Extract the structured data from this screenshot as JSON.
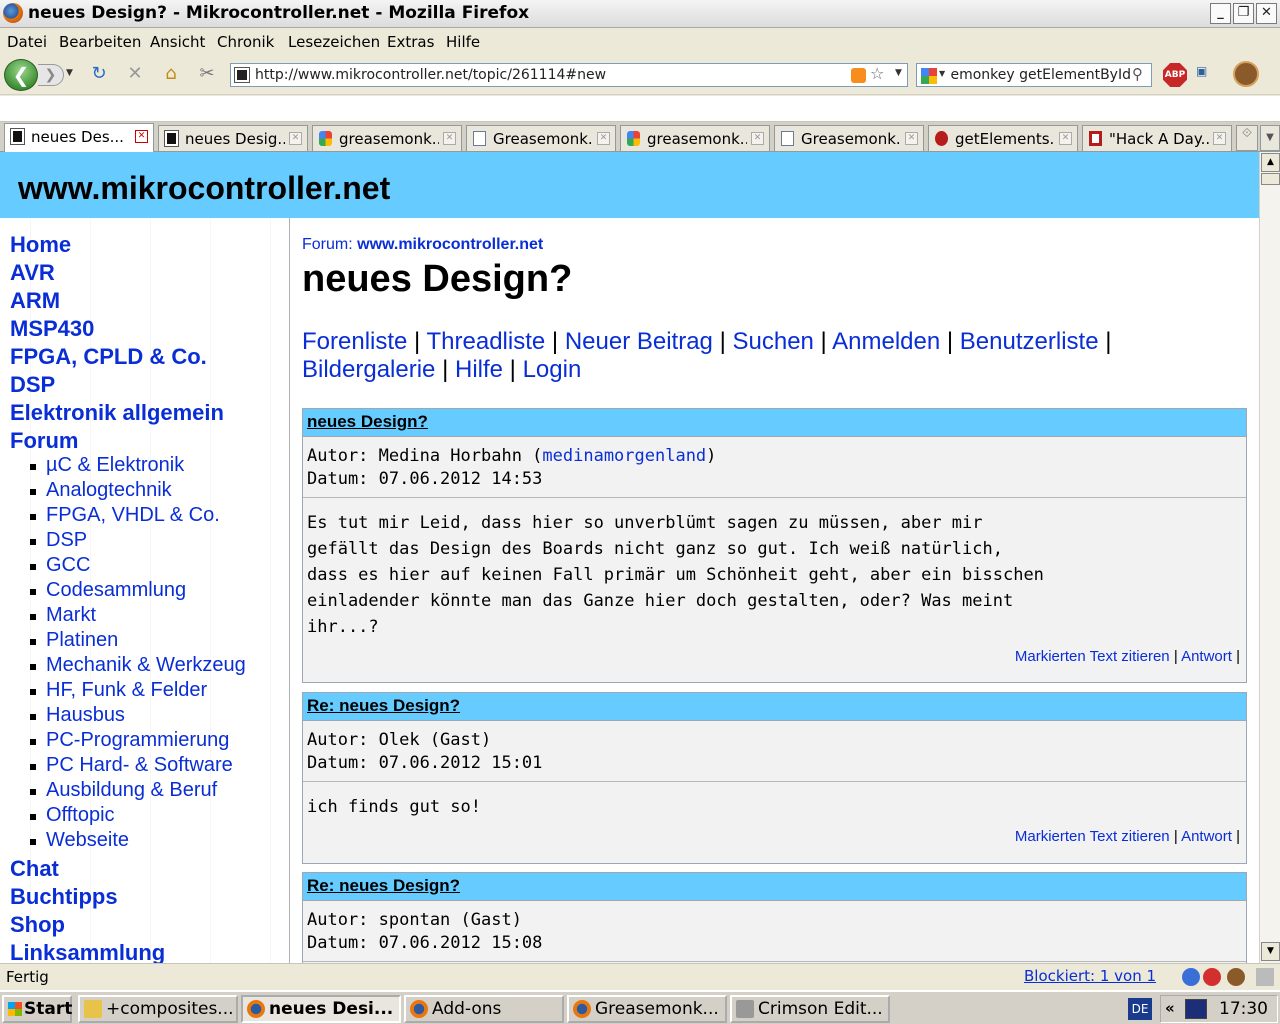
{
  "window": {
    "title": "neues Design? - Mikrocontroller.net - Mozilla Firefox",
    "min": "_",
    "max": "❐",
    "close": "✕"
  },
  "menu": [
    "Datei",
    "Bearbeiten",
    "Ansicht",
    "Chronik",
    "Lesezeichen",
    "Extras",
    "Hilfe"
  ],
  "nav": {
    "url": "http://www.mikrocontroller.net/topic/261114#new",
    "search_value": "emonkey getElementById",
    "abp_label": "ABP"
  },
  "tabs": [
    {
      "label": "neues Des...",
      "icon": "page-icon",
      "active": true
    },
    {
      "label": "neues Desig...",
      "icon": "page-icon",
      "active": false
    },
    {
      "label": "greasemonk...",
      "icon": "google-icon",
      "active": false
    },
    {
      "label": "Greasemonk...",
      "icon": "doc-icon",
      "active": false
    },
    {
      "label": "greasemonk...",
      "icon": "google-icon",
      "active": false
    },
    {
      "label": "Greasemonk...",
      "icon": "doc-icon",
      "active": false
    },
    {
      "label": "getElements...",
      "icon": "bug-icon",
      "active": false
    },
    {
      "label": "\"Hack A Day...",
      "icon": "hackaday-icon",
      "active": false
    }
  ],
  "site": {
    "title": "www.mikrocontroller.net"
  },
  "leftnav": {
    "main_top": [
      "Home",
      "AVR",
      "ARM",
      "MSP430",
      "FPGA, CPLD & Co.",
      "DSP",
      "Elektronik allgemein",
      "Forum"
    ],
    "sub": [
      "µC & Elektronik",
      "Analogtechnik",
      "FPGA, VHDL & Co.",
      "DSP",
      "GCC",
      "Codesammlung",
      "Markt",
      "Platinen",
      "Mechanik & Werkzeug",
      "HF, Funk & Felder",
      "Hausbus",
      "PC-Programmierung",
      "PC Hard- & Software",
      "Ausbildung & Beruf",
      "Offtopic",
      "Webseite"
    ],
    "main_bottom": [
      "Chat",
      "Buchtipps",
      "Shop",
      "Linksammlung"
    ]
  },
  "main": {
    "crumb_prefix": "Forum: ",
    "crumb_link": "www.mikrocontroller.net",
    "page_title": "neues Design?",
    "links": [
      "Forenliste",
      "Threadliste",
      "Neuer Beitrag",
      "Suchen",
      "Anmelden",
      "Benutzerliste",
      "Bildergalerie",
      "Hilfe",
      "Login"
    ],
    "separator": " | "
  },
  "posts": [
    {
      "subject": "neues Design?",
      "author_prefix": "Autor: Medina Horbahn (",
      "author_link": "medinamorgenland",
      "author_suffix": ")",
      "date": "Datum: 07.06.2012 14:53",
      "body": "Es tut mir Leid, dass hier so unverblümt sagen zu müssen, aber mir\ngefällt das Design des Boards nicht ganz so gut. Ich weiß natürlich,\ndass es hier auf keinen Fall primär um Schönheit geht, aber ein bisschen\neinladender könnte man das Ganze hier doch gestalten, oder? Was meint\nihr...?",
      "quote": "Markierten Text zitieren",
      "reply": "Antwort"
    },
    {
      "subject": "Re: neues Design?",
      "author_prefix": "Autor: Olek (Gast)",
      "author_link": "",
      "author_suffix": "",
      "date": "Datum: 07.06.2012 15:01",
      "body": "ich finds gut so!",
      "quote": "Markierten Text zitieren",
      "reply": "Antwort"
    },
    {
      "subject": "Re: neues Design?",
      "author_prefix": "Autor: spontan (Gast)",
      "author_link": "",
      "author_suffix": "",
      "date": "Datum: 07.06.2012 15:08",
      "body": "",
      "quote": "",
      "reply": ""
    }
  ],
  "status": {
    "text": "Fertig",
    "blocked": "Blockiert: 1 von 1"
  },
  "taskbar": {
    "start": "Start",
    "items": [
      {
        "label": "+composites...",
        "active": false
      },
      {
        "label": "neues Desi...",
        "active": true
      },
      {
        "label": "Add-ons",
        "active": false
      },
      {
        "label": "Greasemonk...",
        "active": false
      },
      {
        "label": "Crimson Edit...",
        "active": false
      }
    ],
    "lang": "DE",
    "chevron": "«",
    "clock": "17:30"
  }
}
